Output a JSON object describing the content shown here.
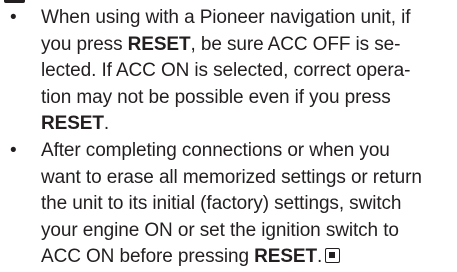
{
  "bullet_glyph": "•",
  "items": [
    {
      "lines": [
        {
          "a": "When using with a Pioneer navigation unit, if"
        },
        {
          "a": "you press ",
          "b": "RESET",
          "c": ", be sure ACC OFF is se-"
        },
        {
          "a": "lected. If ACC ON is selected, correct opera-"
        },
        {
          "a": "tion may not be possible even if you press"
        },
        {
          "b": "RESET",
          "c": "."
        }
      ]
    },
    {
      "lines": [
        {
          "a": "After completing connections or when you"
        },
        {
          "a": "want to erase all memorized settings or return"
        },
        {
          "a": "the unit to its initial (factory) settings, switch"
        },
        {
          "a": "your engine ON or set the ignition switch to"
        },
        {
          "a": "ACC ON before pressing ",
          "b": "RESET",
          "c": "."
        }
      ]
    }
  ],
  "end_mark_icon": "end-of-section-icon"
}
